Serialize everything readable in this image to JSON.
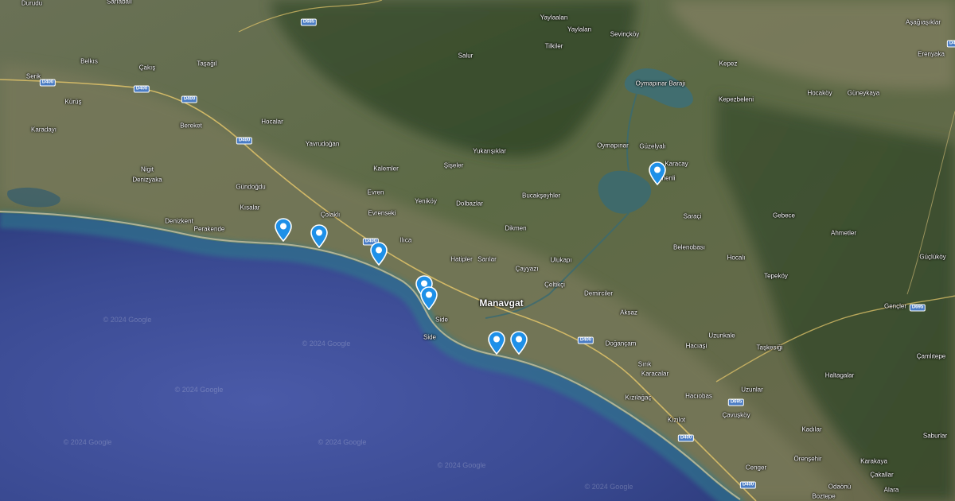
{
  "map": {
    "type": "satellite",
    "colors": {
      "sea": "#3c4d98",
      "shallow_water": "#2f6f86",
      "land": "#5f6b4c",
      "pin": "#1e90e8"
    }
  },
  "places": [
    {
      "id": "side-1",
      "label": "Side"
    },
    {
      "id": "side-2",
      "label": "Side"
    },
    {
      "id": "manavgat",
      "label": "Manavgat",
      "major": true
    },
    {
      "id": "durudu",
      "label": "Durudu"
    },
    {
      "id": "sahabali",
      "label": "Sarıabalı"
    },
    {
      "id": "serik",
      "label": "Serik"
    },
    {
      "id": "belkis",
      "label": "Belkıs"
    },
    {
      "id": "cakis",
      "label": "Çakış"
    },
    {
      "id": "tasagil",
      "label": "Taşağıl"
    },
    {
      "id": "kurus",
      "label": "Kürüş"
    },
    {
      "id": "karadayi",
      "label": "Karadayı"
    },
    {
      "id": "bereket",
      "label": "Bereket"
    },
    {
      "id": "hocalar",
      "label": "Hocalar"
    },
    {
      "id": "yavrudogan",
      "label": "Yavrudoğan"
    },
    {
      "id": "nigit",
      "label": "Nigit"
    },
    {
      "id": "denizyaka",
      "label": "Denizyaka"
    },
    {
      "id": "denizkent",
      "label": "Denizkent"
    },
    {
      "id": "perakende",
      "label": "Perakende"
    },
    {
      "id": "gundogdu",
      "label": "Gündoğdu"
    },
    {
      "id": "kisalar",
      "label": "Kısalar"
    },
    {
      "id": "colakli",
      "label": "Çolaklı"
    },
    {
      "id": "kalemler",
      "label": "Kalemler"
    },
    {
      "id": "evren",
      "label": "Evren"
    },
    {
      "id": "evrenseki",
      "label": "Evrenseki"
    },
    {
      "id": "ilica",
      "label": "Ilıca"
    },
    {
      "id": "yenikoy",
      "label": "Yeniköy"
    },
    {
      "id": "dolbazlar",
      "label": "Dolbazlar"
    },
    {
      "id": "sisalar",
      "label": "Şişeler"
    },
    {
      "id": "yukarisiklar",
      "label": "Yukarışıklar"
    },
    {
      "id": "bucaksevhler",
      "label": "Bucakşeyhler"
    },
    {
      "id": "dikmen",
      "label": "Dikmen"
    },
    {
      "id": "hatipler",
      "label": "Hatipler"
    },
    {
      "id": "sarilar",
      "label": "Sarılar"
    },
    {
      "id": "cavuszu",
      "label": "Çayyazı"
    },
    {
      "id": "ulukapi",
      "label": "Ulukapı"
    },
    {
      "id": "celtikci",
      "label": "Çeltikçi"
    },
    {
      "id": "demirciler",
      "label": "Demirciler"
    },
    {
      "id": "aksaz",
      "label": "Aksaz"
    },
    {
      "id": "dogancami",
      "label": "Doğançam"
    },
    {
      "id": "salur",
      "label": "Salur"
    },
    {
      "id": "yaylaalan",
      "label": "Yaylaalan"
    },
    {
      "id": "yaylalan2",
      "label": "Yaylalan"
    },
    {
      "id": "tilkiler",
      "label": "Tilkiler"
    },
    {
      "id": "sevinckoy",
      "label": "Sevinçköy"
    },
    {
      "id": "oymapinar",
      "label": "Oymapınar"
    },
    {
      "id": "guzelyali",
      "label": "Güzelyalı"
    },
    {
      "id": "karabuca",
      "label": "Karacay"
    },
    {
      "id": "dsenenli",
      "label": "Denenli"
    },
    {
      "id": "saraci",
      "label": "Saraçi"
    },
    {
      "id": "gebece",
      "label": "Gebece"
    },
    {
      "id": "ahmetler",
      "label": "Ahmetler"
    },
    {
      "id": "belenobasi",
      "label": "Belenobası"
    },
    {
      "id": "hocali",
      "label": "Hocalı"
    },
    {
      "id": "tepekoy",
      "label": "Tepeköy"
    },
    {
      "id": "kepez",
      "label": "Kepez"
    },
    {
      "id": "kepezbeleni",
      "label": "Kepezbeleni"
    },
    {
      "id": "hocakoy",
      "label": "Hocaköy"
    },
    {
      "id": "guneykaya",
      "label": "Güneykaya"
    },
    {
      "id": "asagiasiklar",
      "label": "Aşağıaşıklar"
    },
    {
      "id": "erenyaka",
      "label": "Erenyaka"
    },
    {
      "id": "guclukoy",
      "label": "Güçlüköy"
    },
    {
      "id": "gencler",
      "label": "Gençler"
    },
    {
      "id": "camlitepe",
      "label": "Çamlıtepe"
    },
    {
      "id": "taskesigi",
      "label": "Taşkesiği"
    },
    {
      "id": "uzunkale",
      "label": "Uzunkale"
    },
    {
      "id": "haticiasi",
      "label": "Hacıaşi"
    },
    {
      "id": "sirik",
      "label": "Sırık"
    },
    {
      "id": "karacalar",
      "label": "Karacalar"
    },
    {
      "id": "kizilagac",
      "label": "Kızılağaç"
    },
    {
      "id": "hacibobas",
      "label": "Hacıobas"
    },
    {
      "id": "uzunlar",
      "label": "Uzunlar"
    },
    {
      "id": "kizilot",
      "label": "Kızılot"
    },
    {
      "id": "cavuskoy",
      "label": "Çavuşköy"
    },
    {
      "id": "haltagalar",
      "label": "Haltagalar"
    },
    {
      "id": "kadilar",
      "label": "Kadılar"
    },
    {
      "id": "orenseihir",
      "label": "Örenşehir"
    },
    {
      "id": "karakaya",
      "label": "Karakaya"
    },
    {
      "id": "cakallar",
      "label": "Çakallar"
    },
    {
      "id": "cenger",
      "label": "Cenger"
    },
    {
      "id": "odaonu",
      "label": "Odaönü"
    },
    {
      "id": "boztepe",
      "label": "Boztepe"
    },
    {
      "id": "alara",
      "label": "Alara"
    },
    {
      "id": "saburlar",
      "label": "Saburlar"
    },
    {
      "id": "oymapinar-baraji",
      "label": "Oymapınar Barajı"
    }
  ],
  "roads": [
    {
      "id": "r1",
      "label": "D400"
    },
    {
      "id": "r2",
      "label": "D400"
    },
    {
      "id": "r3",
      "label": "D400"
    },
    {
      "id": "r4",
      "label": "D400"
    },
    {
      "id": "r5",
      "label": "D400"
    },
    {
      "id": "r6",
      "label": "D400"
    },
    {
      "id": "r7",
      "label": "D695"
    },
    {
      "id": "r8",
      "label": "D695"
    },
    {
      "id": "r9",
      "label": "D685"
    },
    {
      "id": "r10",
      "label": "D400"
    },
    {
      "id": "r11",
      "label": "D400"
    },
    {
      "id": "r12",
      "label": "D400"
    },
    {
      "id": "r13",
      "label": "D400"
    },
    {
      "id": "r14",
      "label": "D400"
    }
  ],
  "markers": [
    {
      "id": "pin-1",
      "label": "location-marker"
    },
    {
      "id": "pin-2",
      "label": "location-marker"
    },
    {
      "id": "pin-3",
      "label": "location-marker"
    },
    {
      "id": "pin-4",
      "label": "location-marker"
    },
    {
      "id": "pin-5",
      "label": "location-marker"
    },
    {
      "id": "pin-6",
      "label": "location-marker"
    },
    {
      "id": "pin-7",
      "label": "location-marker"
    },
    {
      "id": "pin-8",
      "label": "location-marker"
    }
  ],
  "watermark": "© 2024 Google"
}
